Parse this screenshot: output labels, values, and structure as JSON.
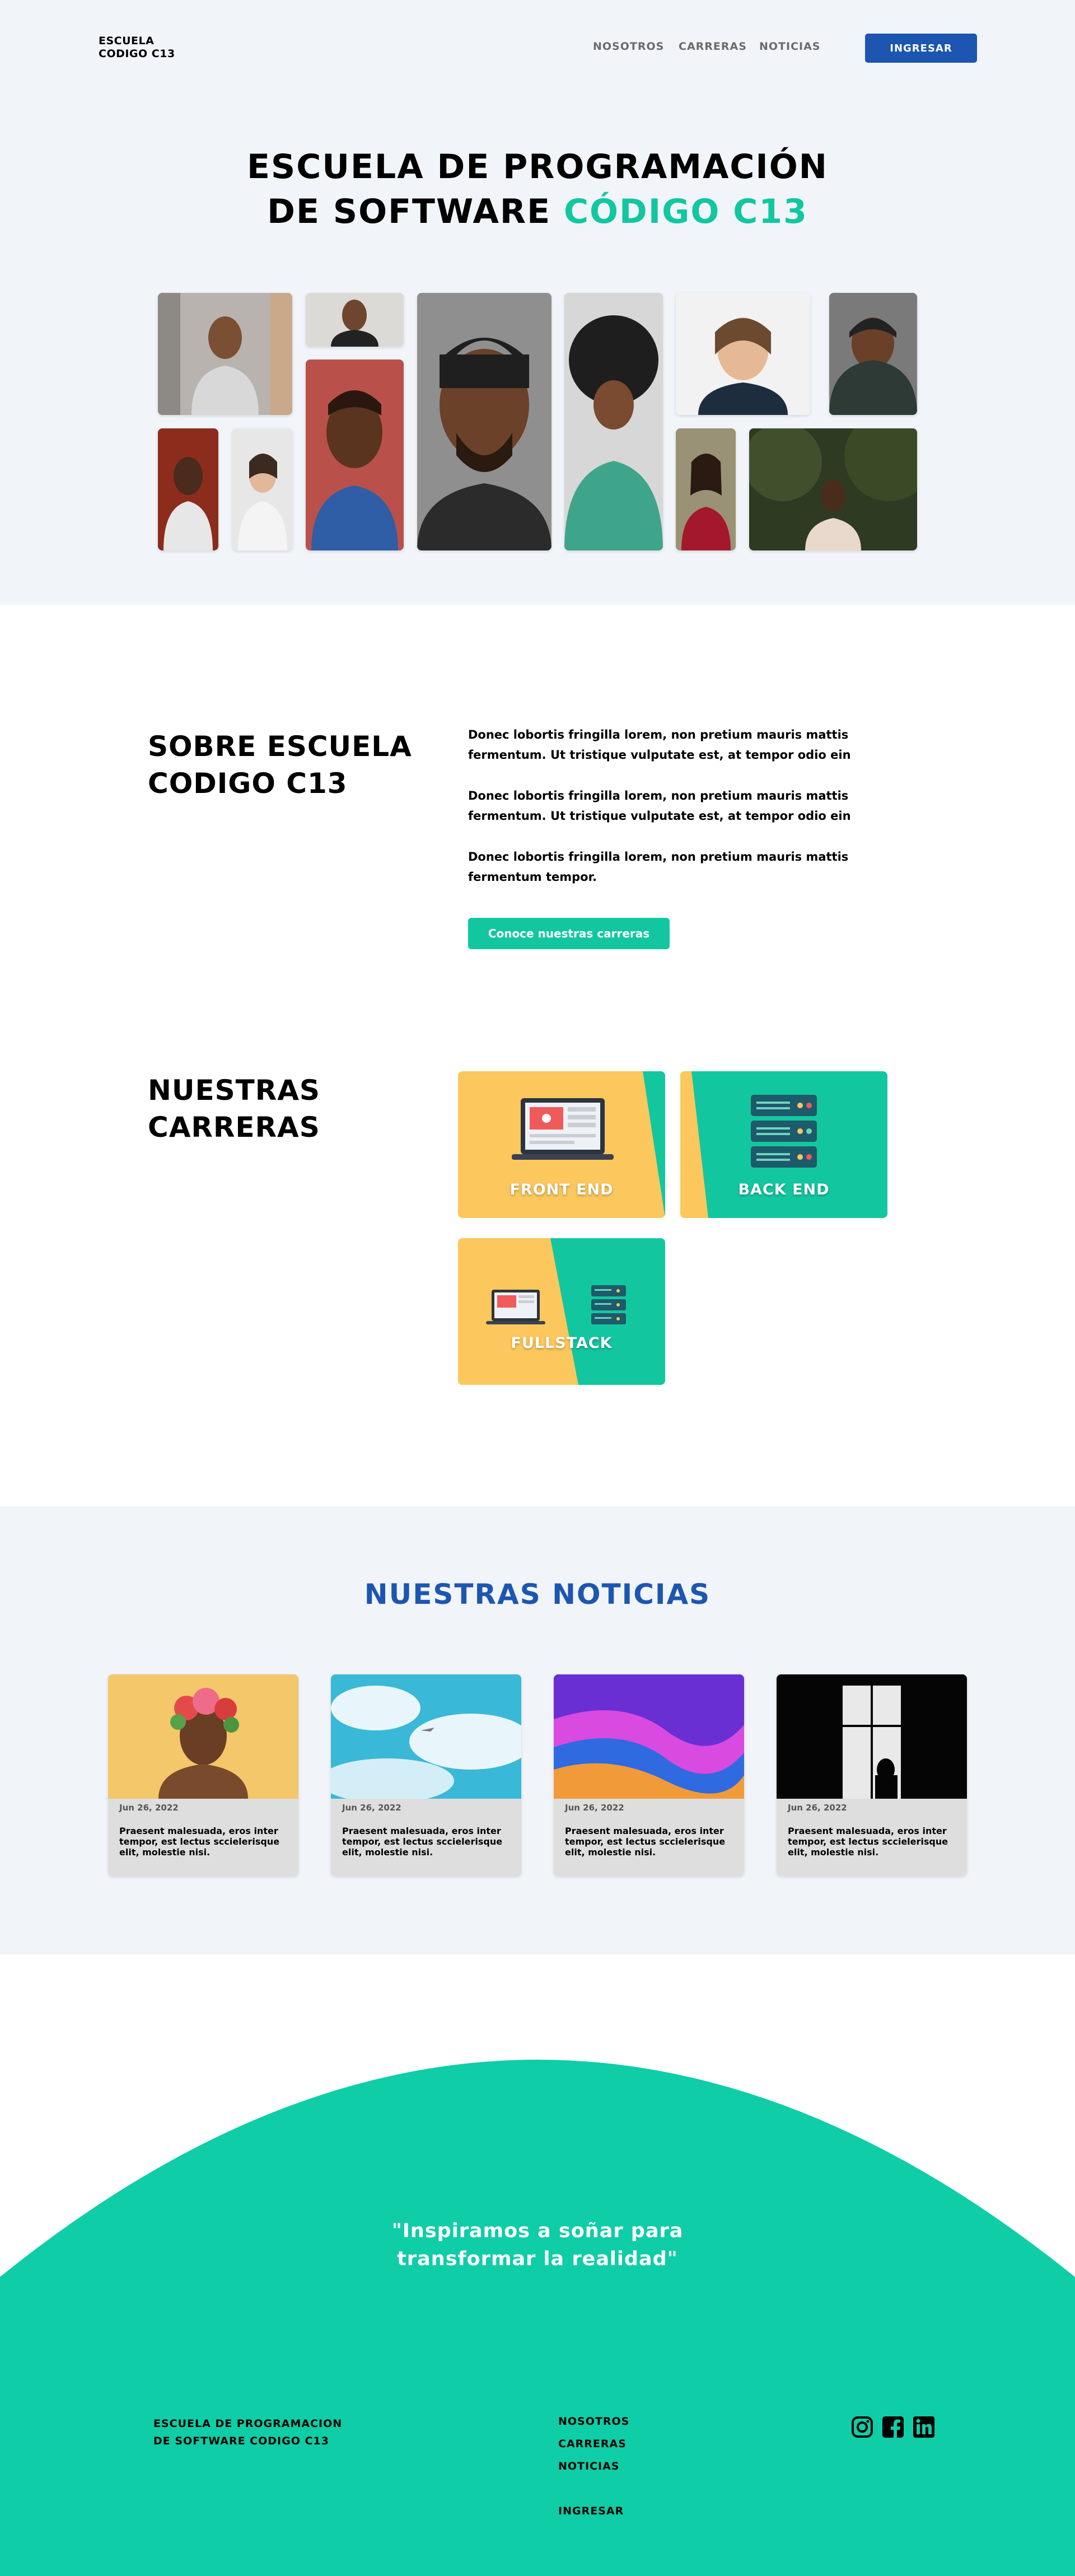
{
  "header": {
    "brand_line1": "ESCUELA",
    "brand_line2": "CODIGO C13",
    "nav": [
      "NOSOTROS",
      "CARRERAS",
      "NOTICIAS"
    ],
    "cta_label": "INGRESAR"
  },
  "hero": {
    "title_line1": "ESCUELA DE PROGRAMACIÓN",
    "title_line2_part1": "DE SOFTWARE ",
    "title_line2_accent": "CÓDIGO C13"
  },
  "about": {
    "title_line1": "SOBRE ESCUELA",
    "title_line2": "CODIGO C13",
    "paragraphs": [
      "Donec lobortis fringilla lorem, non pretium mauris mattis fermentum. Ut tristique vulputate est, at tempor odio ein",
      "Donec lobortis fringilla lorem, non pretium mauris mattis fermentum. Ut tristique vulputate est, at tempor odio ein",
      "Donec lobortis fringilla lorem, non pretium mauris mattis fermentum tempor."
    ],
    "button_label": "Conoce nuestras carreras"
  },
  "careers": {
    "title_line1": "NUESTRAS",
    "title_line2": "CARRERAS",
    "items": [
      {
        "label": "FRONT END"
      },
      {
        "label": "BACK END"
      },
      {
        "label": "FULLSTACK"
      }
    ]
  },
  "news": {
    "title": "NUESTRAS NOTICIAS",
    "items": [
      {
        "date": "Jun 26, 2022",
        "text": "Praesent malesuada, eros inter tempor, est lectus sccielerisque elit, molestie nisi."
      },
      {
        "date": "Jun 26, 2022",
        "text": "Praesent malesuada, eros inter tempor, est lectus sccielerisque elit, molestie nisi."
      },
      {
        "date": "Jun 26, 2022",
        "text": "Praesent malesuada, eros inter tempor, est lectus sccielerisque elit, molestie nisi."
      },
      {
        "date": "Jun 26, 2022",
        "text": "Praesent malesuada, eros inter tempor, est lectus sccielerisque elit, molestie nisi."
      }
    ]
  },
  "footer": {
    "quote_line1": "\"Inspiramos a soñar para",
    "quote_line2": "transformar la realidad\"",
    "brand_line1": "ESCUELA DE PROGRAMACION",
    "brand_line2": "DE SOFTWARE CODIGO C13",
    "links": [
      "NOSOTROS",
      "CARRERAS",
      "NOTICIAS"
    ],
    "login_label": "INGRESAR",
    "social": [
      "instagram-icon",
      "facebook-icon",
      "linkedin-icon"
    ]
  },
  "colors": {
    "accent_green": "#12c7a0",
    "accent_blue": "#1c56b0",
    "card_yellow": "#fcc75c",
    "hero_bg": "#f1f4f9"
  }
}
